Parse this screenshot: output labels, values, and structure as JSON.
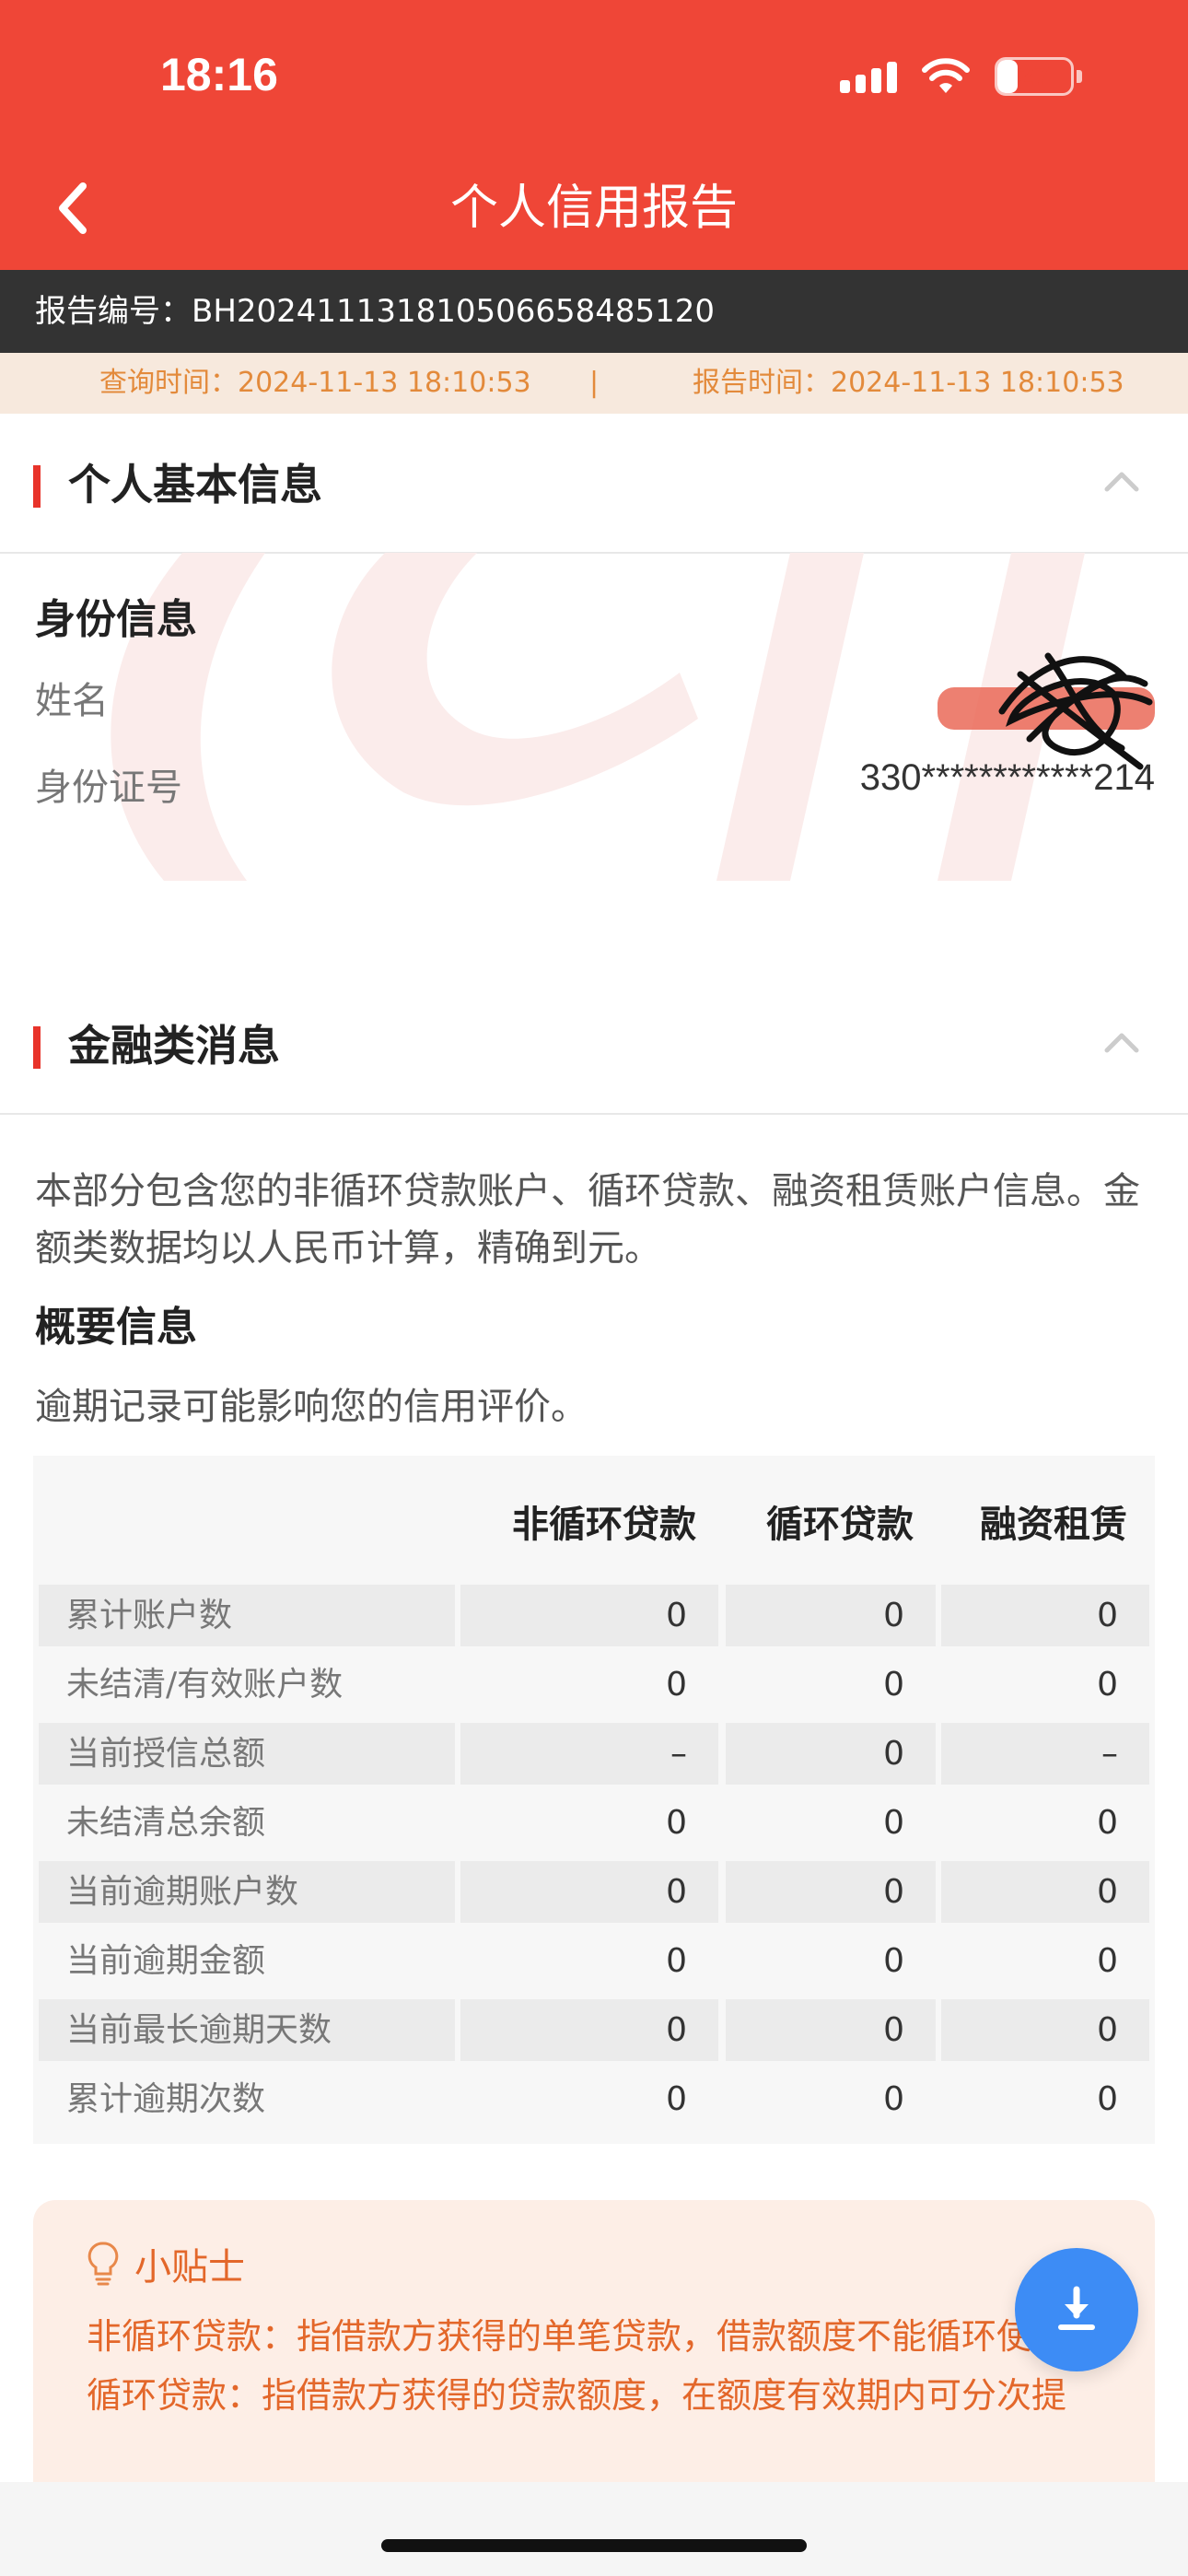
{
  "status_bar": {
    "time": "18:16",
    "battery": "27",
    "battery_level": 0.27
  },
  "nav": {
    "title": "个人信用报告"
  },
  "report": {
    "number_label": "报告编号：BH20241113181050665848512​0",
    "query_time": "查询时间：2024-11-13 18:10:53",
    "separator": "|",
    "report_time": "报告时间：2024-11-13 18:10:53"
  },
  "basic_info": {
    "section_title": "个人基本信息",
    "sub_title": "身份信息",
    "name_label": "姓名",
    "id_label": "身份证号",
    "id_value": "330************214"
  },
  "finance": {
    "section_title": "金融类消息",
    "description": "本部分包含您的非循环贷款账户、循环贷款、融资租赁账户信息。金额类数据均以人民币计算，精确到元。",
    "summary_title": "概要信息",
    "hint": "逾期记录可能影响您的信用评价。",
    "table": {
      "headers": [
        "非循环贷款",
        "循环贷款",
        "融资租赁"
      ],
      "rows": [
        {
          "label": "累计账户数",
          "values": [
            "0",
            "0",
            "0"
          ]
        },
        {
          "label": "未结清/有效账户数",
          "values": [
            "0",
            "0",
            "0"
          ]
        },
        {
          "label": "当前授信总额",
          "values": [
            "–",
            "0",
            "–"
          ]
        },
        {
          "label": "未结清总余额",
          "values": [
            "0",
            "0",
            "0"
          ]
        },
        {
          "label": "当前逾期账户数",
          "values": [
            "0",
            "0",
            "0"
          ]
        },
        {
          "label": "当前逾期金额",
          "values": [
            "0",
            "0",
            "0"
          ]
        },
        {
          "label": "当前最长逾期天数",
          "values": [
            "0",
            "0",
            "0"
          ]
        },
        {
          "label": "累计逾期次数",
          "values": [
            "0",
            "0",
            "0"
          ]
        }
      ]
    }
  },
  "tips": {
    "title": "小贴士",
    "items": [
      "非循环贷款：指借款方获得的单笔贷款，借款额度不能循环使用。",
      "循环贷款：指借款方获得的贷款额度，在额度有效期内可分次提"
    ]
  },
  "colors": {
    "brand_red": "#ef4637",
    "accent_orange": "#e38a3b",
    "fab_blue": "#3d8cf5"
  },
  "icons": {
    "back": "chevron-left-icon",
    "collapse": "chevron-up-icon",
    "tips": "lightbulb-icon",
    "fab": "download-icon"
  }
}
